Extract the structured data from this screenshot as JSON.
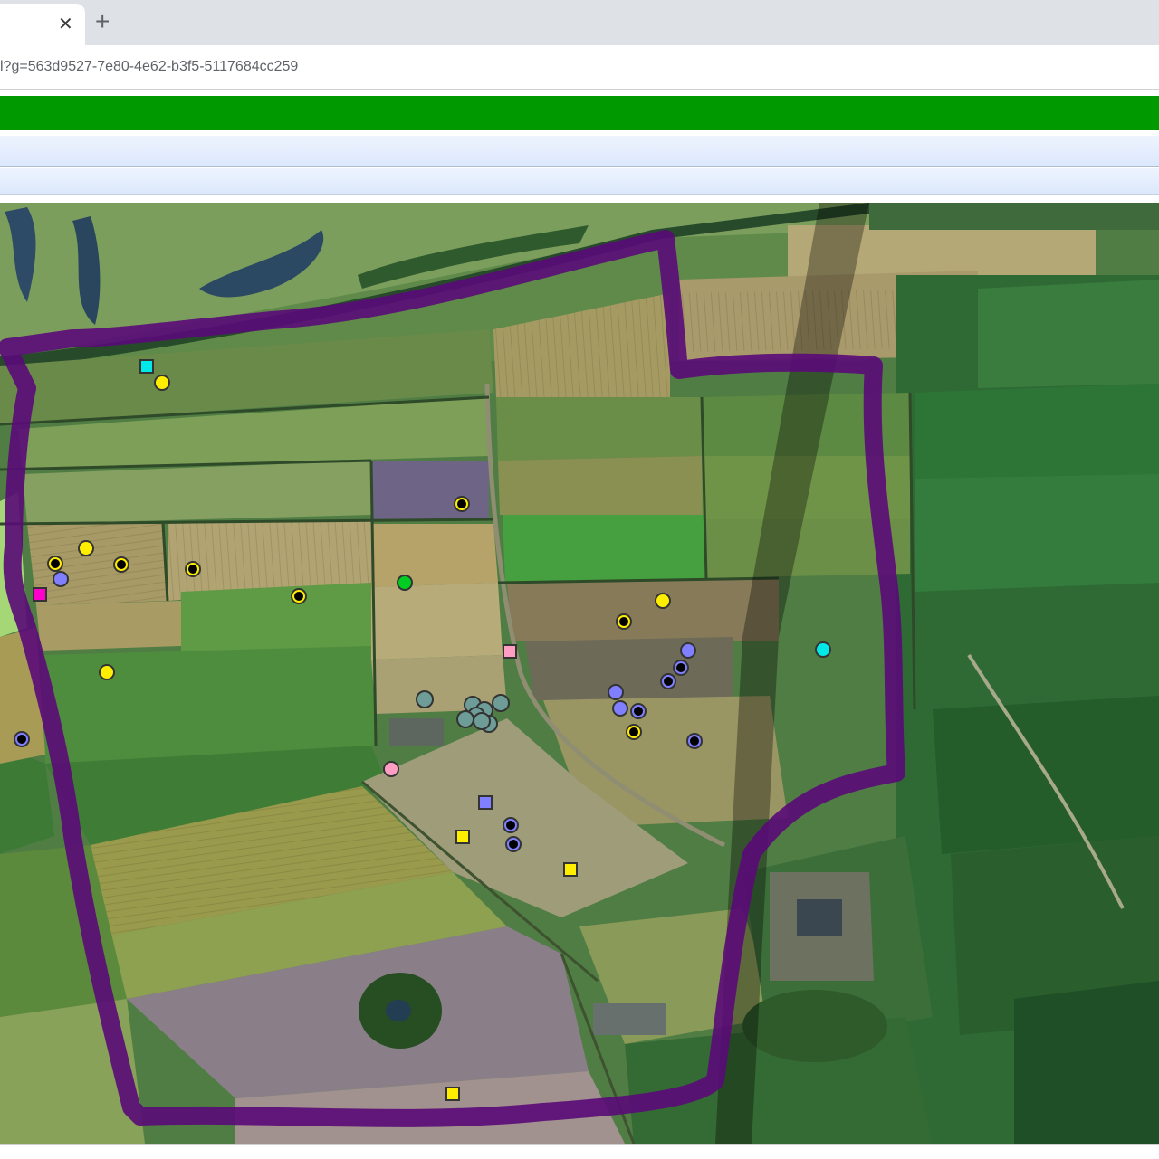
{
  "browser": {
    "tab_close_glyph": "✕",
    "new_tab_glyph": "+",
    "url": "l?g=563d9527-7e80-4e62-b3f5-5117684cc259"
  },
  "colors": {
    "header_band": "#009900",
    "boundary": "#5a0a78",
    "yellow": "#ffee00",
    "blue": "#7f7fff",
    "magenta": "#ff00cc",
    "cyan": "#00e8e8",
    "pink": "#ff9ec2",
    "green": "#00cc22",
    "gray_teal": "#6e9c96"
  },
  "map": {
    "kind": "satellite imagery of farmland with a drawn survey boundary",
    "markers": [
      {
        "shape": "square",
        "color": "cyan"
      },
      {
        "shape": "circle",
        "color": "yellow"
      },
      {
        "shape": "circle",
        "color": "yellow",
        "center_dot": true
      },
      {
        "shape": "circle",
        "color": "yellow"
      },
      {
        "shape": "circle",
        "color": "yellow",
        "center_dot": true
      },
      {
        "shape": "circle",
        "color": "blue"
      },
      {
        "shape": "circle",
        "color": "yellow",
        "center_dot": true
      },
      {
        "shape": "circle",
        "color": "yellow",
        "center_dot": true
      },
      {
        "shape": "square",
        "color": "magenta"
      },
      {
        "shape": "circle",
        "color": "yellow",
        "center_dot": true
      },
      {
        "shape": "circle",
        "color": "green"
      },
      {
        "shape": "circle",
        "color": "yellow"
      },
      {
        "shape": "circle",
        "color": "yellow",
        "center_dot": true
      },
      {
        "shape": "square",
        "color": "pink"
      },
      {
        "shape": "circle",
        "color": "blue"
      },
      {
        "shape": "circle",
        "color": "blue",
        "center_dot": true
      },
      {
        "shape": "circle",
        "color": "blue",
        "center_dot": true
      },
      {
        "shape": "circle",
        "color": "cyan"
      },
      {
        "shape": "circle",
        "color": "yellow"
      },
      {
        "shape": "circle",
        "color": "blue"
      },
      {
        "shape": "circle",
        "color": "blue"
      },
      {
        "shape": "circle",
        "color": "blue",
        "center_dot": true
      },
      {
        "shape": "circle",
        "color": "yellow",
        "center_dot": true
      },
      {
        "shape": "circle",
        "color": "blue",
        "center_dot": true
      },
      {
        "shape": "circle",
        "color": "blue",
        "center_dot": true
      },
      {
        "shape": "circle",
        "color": "gray_teal"
      },
      {
        "shape": "circle",
        "color": "gray_teal"
      },
      {
        "shape": "circle",
        "color": "gray_teal"
      },
      {
        "shape": "circle",
        "color": "gray_teal"
      },
      {
        "shape": "circle",
        "color": "gray_teal"
      },
      {
        "shape": "circle",
        "color": "gray_teal"
      },
      {
        "shape": "circle",
        "color": "gray_teal"
      },
      {
        "shape": "circle",
        "color": "gray_teal"
      },
      {
        "shape": "circle",
        "color": "pink"
      },
      {
        "shape": "square",
        "color": "blue"
      },
      {
        "shape": "square",
        "color": "yellow"
      },
      {
        "shape": "circle",
        "color": "blue",
        "center_dot": true
      },
      {
        "shape": "circle",
        "color": "blue",
        "center_dot": true
      },
      {
        "shape": "square",
        "color": "yellow"
      },
      {
        "shape": "square",
        "color": "yellow"
      }
    ]
  }
}
